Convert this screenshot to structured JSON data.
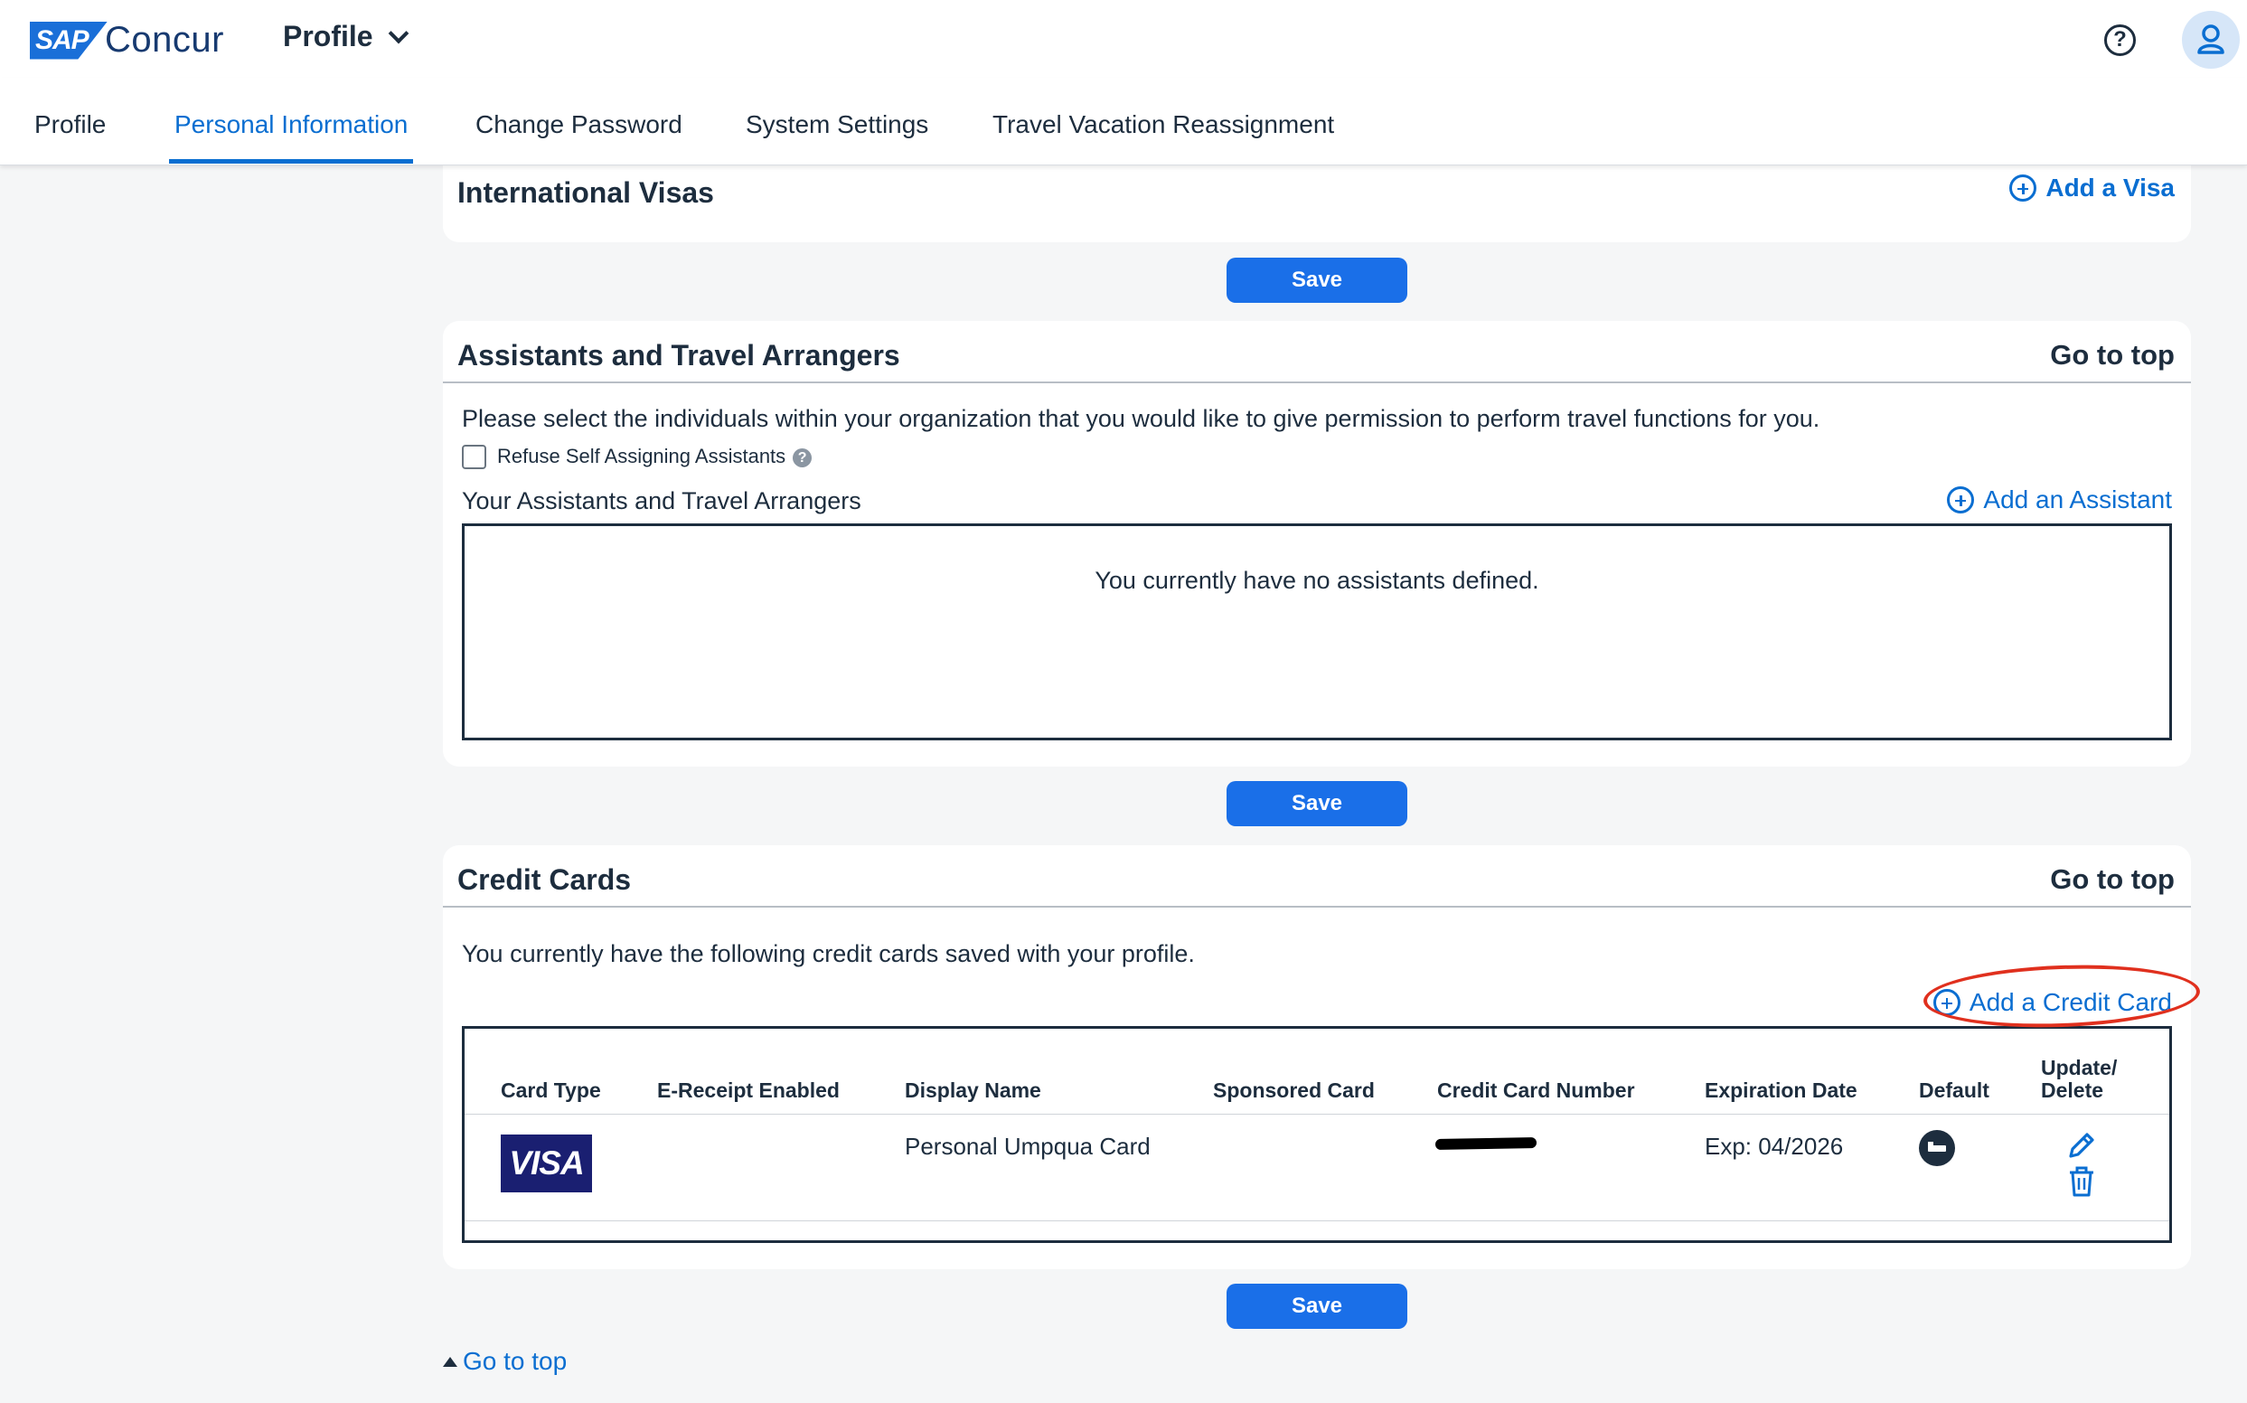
{
  "header": {
    "brand_badge": "SAP",
    "brand_name": "Concur",
    "app_menu_label": "Profile",
    "help_label": "?"
  },
  "tabs": [
    {
      "label": "Profile",
      "active": false
    },
    {
      "label": "Personal Information",
      "active": true
    },
    {
      "label": "Change Password",
      "active": false
    },
    {
      "label": "System Settings",
      "active": false
    },
    {
      "label": "Travel Vacation Reassignment",
      "active": false
    }
  ],
  "visas": {
    "title": "International Visas",
    "add_label": "Add a Visa",
    "save_label": "Save"
  },
  "assistants": {
    "title": "Assistants and Travel Arrangers",
    "goto_label": "Go to top",
    "description": "Please select the individuals within your organization that you would like to give permission to perform travel functions for you.",
    "refuse_checkbox_label": "Refuse Self Assigning Assistants",
    "refuse_checked": false,
    "help_glyph": "?",
    "list_title": "Your Assistants and Travel Arrangers",
    "add_label": "Add an Assistant",
    "empty_message": "You currently have no assistants defined.",
    "save_label": "Save"
  },
  "credit_cards": {
    "title": "Credit Cards",
    "goto_label": "Go to top",
    "description": "You currently have the following credit cards saved with your profile.",
    "add_label": "Add a Credit Card",
    "columns": {
      "card_type": "Card Type",
      "ereceipt": "E-Receipt Enabled",
      "display_name": "Display Name",
      "sponsored": "Sponsored Card",
      "number": "Credit Card Number",
      "expiration": "Expiration Date",
      "default": "Default",
      "update_delete_1": "Update/",
      "update_delete_2": "Delete"
    },
    "rows": [
      {
        "card_type_logo": "VISA",
        "ereceipt": "",
        "display_name": "Personal Umpqua Card",
        "sponsored": "",
        "number": "",
        "expiration": "Exp: 04/2026",
        "default_icon": "travel-bed-icon"
      }
    ],
    "save_label": "Save"
  },
  "footer": {
    "go_to_top_label": "Go to top"
  },
  "colors": {
    "accent": "#0a6ed1",
    "button": "#1a6fe8",
    "annotation": "#e0301e",
    "visa_blue": "#1a1f71"
  }
}
